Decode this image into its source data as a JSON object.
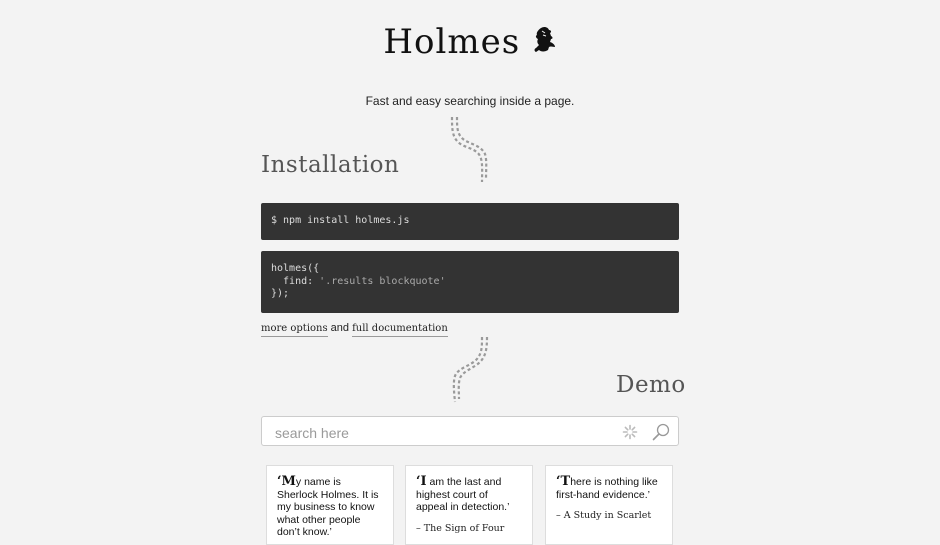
{
  "brand": {
    "title": "Holmes",
    "logo_icon": "sherlock-silhouette-icon"
  },
  "tagline": "Fast and easy searching inside a page.",
  "installation": {
    "title": "Installation",
    "install_command": "$ npm install holmes.js",
    "code_line1": "holmes({",
    "code_line2_key": "  find: ",
    "code_line2_value": "'.results blockquote'",
    "code_line3": "});"
  },
  "links": {
    "more_options": "more options",
    "joiner": " and ",
    "full_documentation": "full documentation"
  },
  "demo": {
    "title": "Demo",
    "search_placeholder": "search here",
    "search_value": "",
    "spinner_icon": "spinner-icon",
    "search_icon": "magnifier-icon"
  },
  "quotes": [
    {
      "first": "‘M",
      "rest": "y name is Sherlock Holmes. It is my business to know what other people don’t know.’",
      "source": ""
    },
    {
      "first": "‘I",
      "rest": " am the last and highest court of appeal in detection.’",
      "source": "– The Sign of Four"
    },
    {
      "first": "‘T",
      "rest": "here is nothing like first-hand evidence.’",
      "source": "– A Study in Scarlet"
    }
  ]
}
